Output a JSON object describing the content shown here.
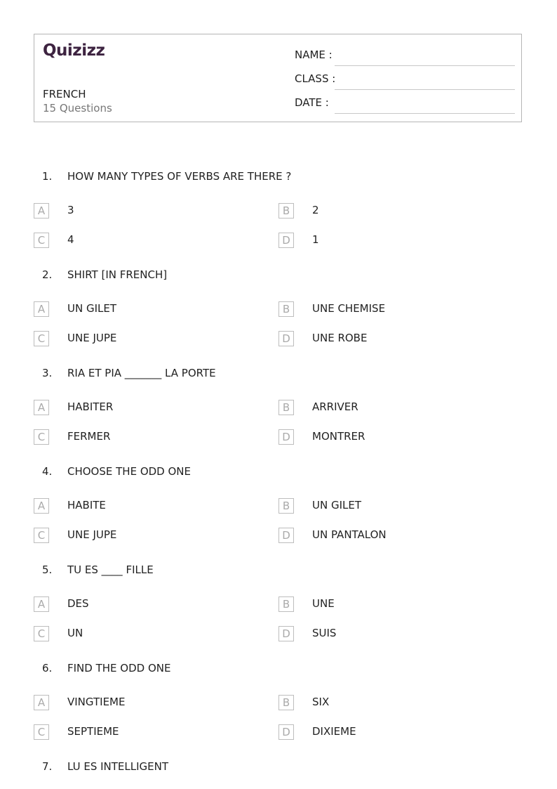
{
  "header": {
    "logo": "Quizizz",
    "subject": "FRENCH",
    "question_count": "15 Questions",
    "fields": [
      {
        "label": "NAME :"
      },
      {
        "label": "CLASS :"
      },
      {
        "label": "DATE  :"
      }
    ]
  },
  "questions": [
    {
      "number": "1.",
      "text": "HOW MANY TYPES OF VERBS ARE THERE ?",
      "options": [
        {
          "letter": "A",
          "text": "3"
        },
        {
          "letter": "B",
          "text": "2"
        },
        {
          "letter": "C",
          "text": "4"
        },
        {
          "letter": "D",
          "text": "1"
        }
      ]
    },
    {
      "number": "2.",
      "text": "SHIRT [IN FRENCH]",
      "options": [
        {
          "letter": "A",
          "text": "UN GILET"
        },
        {
          "letter": "B",
          "text": "UNE CHEMISE"
        },
        {
          "letter": "C",
          "text": "UNE JUPE"
        },
        {
          "letter": "D",
          "text": "UNE ROBE"
        }
      ]
    },
    {
      "number": "3.",
      "text": "RIA ET PIA _______ LA PORTE",
      "options": [
        {
          "letter": "A",
          "text": "HABITER"
        },
        {
          "letter": "B",
          "text": "ARRIVER"
        },
        {
          "letter": "C",
          "text": "FERMER"
        },
        {
          "letter": "D",
          "text": "MONTRER"
        }
      ]
    },
    {
      "number": "4.",
      "text": "CHOOSE THE ODD ONE",
      "options": [
        {
          "letter": "A",
          "text": "HABITE"
        },
        {
          "letter": "B",
          "text": "UN GILET"
        },
        {
          "letter": "C",
          "text": "UNE JUPE"
        },
        {
          "letter": "D",
          "text": "UN PANTALON"
        }
      ]
    },
    {
      "number": "5.",
      "text": "TU ES ____ FILLE",
      "options": [
        {
          "letter": "A",
          "text": "DES"
        },
        {
          "letter": "B",
          "text": "UNE"
        },
        {
          "letter": "C",
          "text": "UN"
        },
        {
          "letter": "D",
          "text": "SUIS"
        }
      ]
    },
    {
      "number": "6.",
      "text": "FIND THE ODD ONE",
      "options": [
        {
          "letter": "A",
          "text": "VINGTIEME"
        },
        {
          "letter": "B",
          "text": "SIX"
        },
        {
          "letter": "C",
          "text": "SEPTIEME"
        },
        {
          "letter": "D",
          "text": "DIXIEME"
        }
      ]
    },
    {
      "number": "7.",
      "text": "LU ES INTELLIGENT",
      "options": []
    }
  ]
}
